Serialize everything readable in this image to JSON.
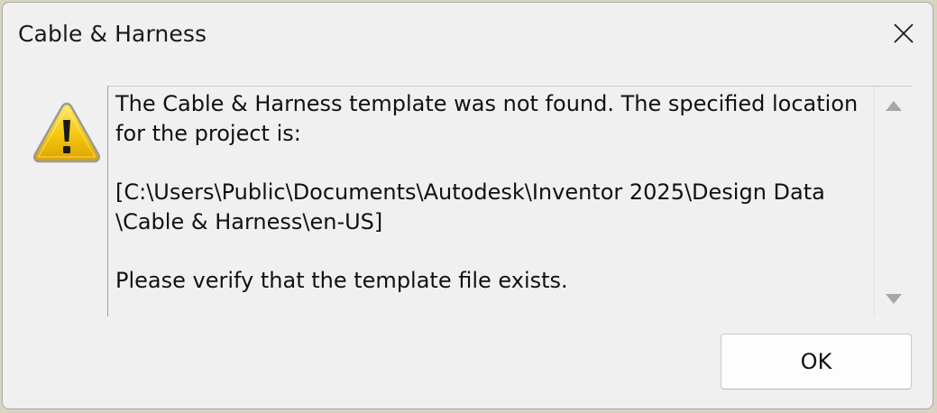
{
  "window": {
    "title": "Cable & Harness"
  },
  "icons": {
    "close": "close-icon",
    "warning": "warning-icon"
  },
  "message": {
    "line1": "The Cable & Harness template was not found. The specified location",
    "line2": "for the project is:",
    "line3": "[C:\\Users\\Public\\Documents\\Autodesk\\Inventor 2025\\Design Data",
    "line4": "\\Cable & Harness\\en-US]",
    "line5": "Please verify that the template file exists."
  },
  "buttons": {
    "ok_label": "OK"
  },
  "colors": {
    "dialog_bg": "#f0f0f0",
    "warning_yellow": "#f2c40f",
    "scroll_arrow": "#a6a6a6"
  }
}
